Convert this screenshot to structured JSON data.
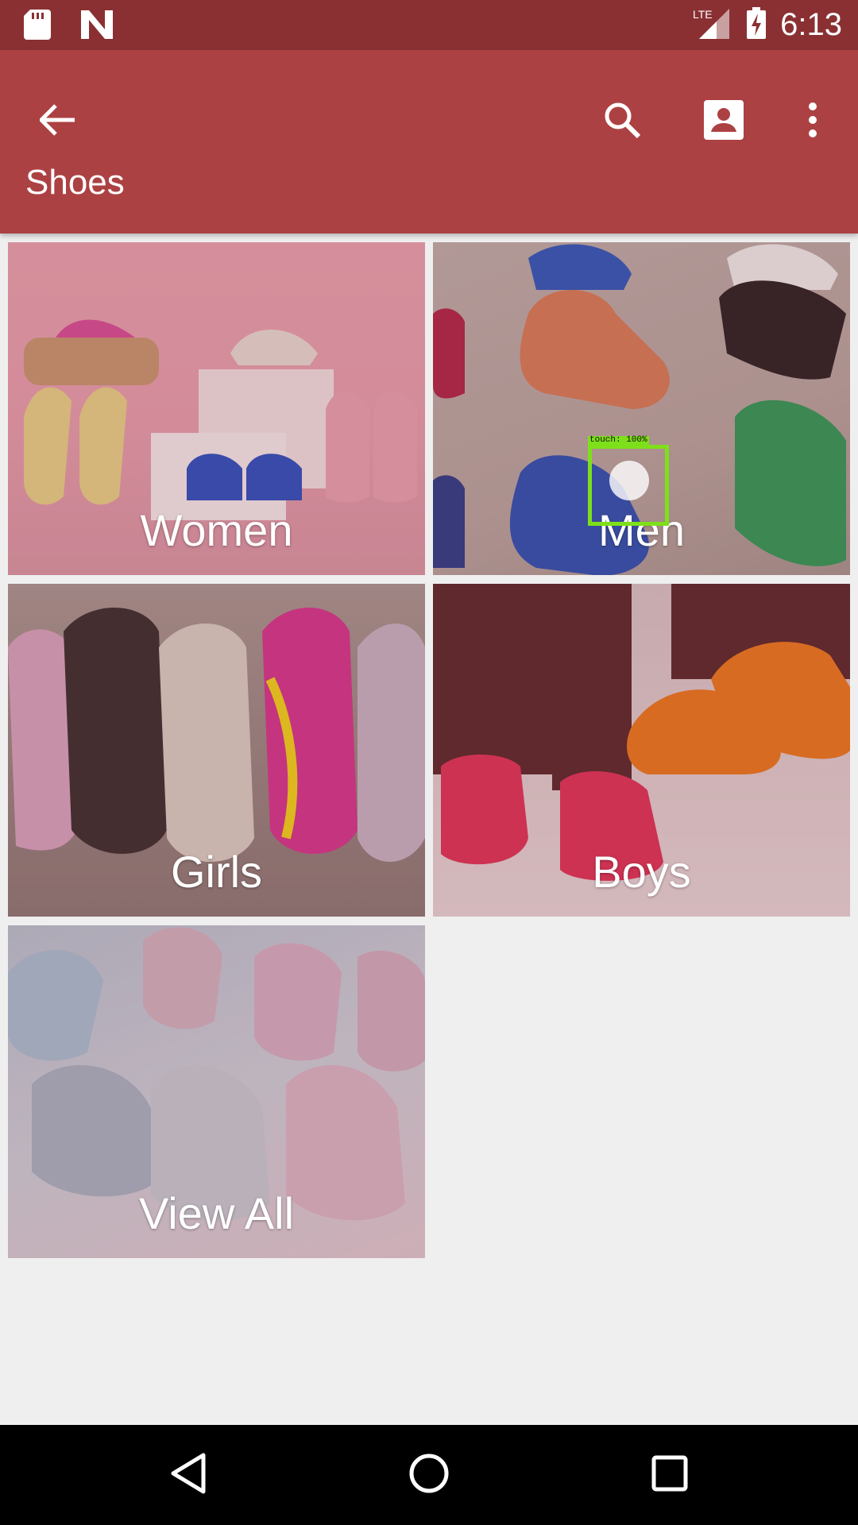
{
  "status_bar": {
    "time": "6:13",
    "network": "LTE",
    "icons": [
      "sd-card-icon",
      "n-notification-icon",
      "lte-signal-icon",
      "battery-charging-icon"
    ]
  },
  "app_bar": {
    "title": "Shoes",
    "actions": [
      "back-arrow-icon",
      "search-icon",
      "account-box-icon",
      "more-vert-icon"
    ]
  },
  "categories": [
    {
      "label": "Women"
    },
    {
      "label": "Men"
    },
    {
      "label": "Girls"
    },
    {
      "label": "Boys"
    },
    {
      "label": "View All"
    }
  ],
  "touch_indicator": {
    "label": "touch: 100%"
  },
  "nav_bar": {
    "buttons": [
      "back-triangle-icon",
      "home-circle-icon",
      "recents-square-icon"
    ]
  },
  "colors": {
    "status_bar": "#8a3033",
    "app_bar": "#ac4143",
    "background": "#efefef"
  }
}
